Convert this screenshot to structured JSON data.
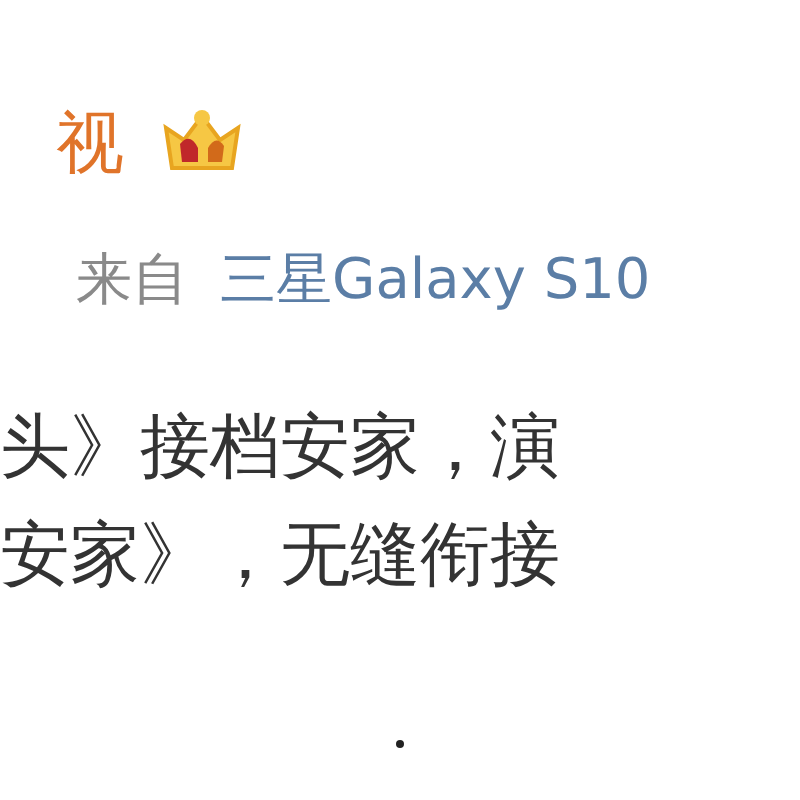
{
  "author": {
    "name": "视",
    "vip": true
  },
  "meta": {
    "source_label": "来自",
    "device": "三星Galaxy S10"
  },
  "body_lines": [
    "头》接档安家，演",
    "安家》，无缝衔接"
  ]
}
